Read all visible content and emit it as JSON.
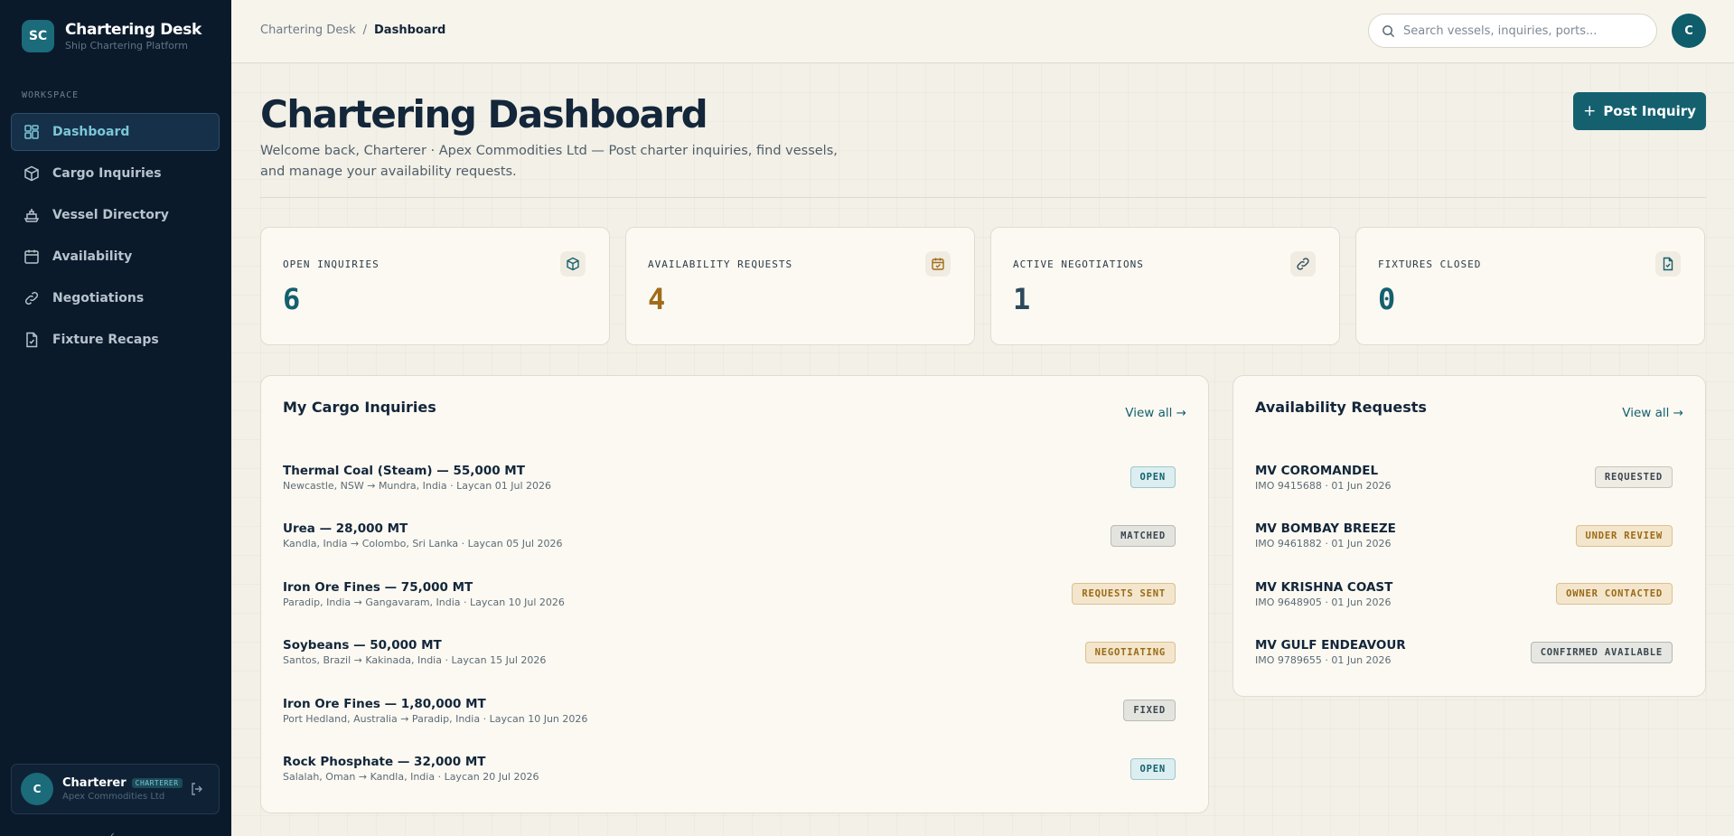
{
  "brand": {
    "logo": "SC",
    "title": "Chartering Desk",
    "subtitle": "Ship Chartering Platform"
  },
  "sidebar": {
    "section_label": "WORKSPACE",
    "items": [
      {
        "label": "Dashboard",
        "icon": "grid-icon"
      },
      {
        "label": "Cargo Inquiries",
        "icon": "box-icon"
      },
      {
        "label": "Vessel Directory",
        "icon": "ship-icon"
      },
      {
        "label": "Availability",
        "icon": "calendar-icon"
      },
      {
        "label": "Negotiations",
        "icon": "link-icon"
      },
      {
        "label": "Fixture Recaps",
        "icon": "document-icon"
      }
    ],
    "user": {
      "initial": "C",
      "name": "Charterer",
      "role": "CHARTERER",
      "org": "Apex Commodities Ltd"
    }
  },
  "topbar": {
    "breadcrumb": {
      "root": "Chartering Desk",
      "sep": "/",
      "current": "Dashboard"
    },
    "search_placeholder": "Search vessels, inquiries, ports...",
    "avatar": "C"
  },
  "page": {
    "title": "Chartering Dashboard",
    "subtitle": "Welcome back, Charterer · Apex Commodities Ltd — Post charter inquiries, find vessels, and manage your availability requests.",
    "post_button": {
      "plus": "+",
      "label": "Post Inquiry"
    }
  },
  "stats": [
    {
      "label": "OPEN INQUIRIES",
      "value": "6",
      "color": "#14606f",
      "icon": "box-icon"
    },
    {
      "label": "AVAILABILITY REQUESTS",
      "value": "4",
      "color": "#a06c1a",
      "icon": "calendar-check-icon"
    },
    {
      "label": "ACTIVE NEGOTIATIONS",
      "value": "1",
      "color": "#2c4a5c",
      "icon": "link-icon"
    },
    {
      "label": "FIXTURES CLOSED",
      "value": "0",
      "color": "#14606f",
      "icon": "document-check-icon"
    }
  ],
  "inquiries": {
    "title": "My Cargo Inquiries",
    "view_all": "View all →",
    "rows": [
      {
        "title": "Thermal Coal (Steam) — 55,000 MT",
        "sub": "Newcastle, NSW → Mundra, India · Laycan 01 Jul 2026",
        "status": "OPEN",
        "cls": "b-open"
      },
      {
        "title": "Urea — 28,000 MT",
        "sub": "Kandla, India → Colombo, Sri Lanka · Laycan 05 Jul 2026",
        "status": "MATCHED",
        "cls": "b-matched"
      },
      {
        "title": "Iron Ore Fines — 75,000 MT",
        "sub": "Paradip, India → Gangavaram, India · Laycan 10 Jul 2026",
        "status": "REQUESTS SENT",
        "cls": "b-amber"
      },
      {
        "title": "Soybeans — 50,000 MT",
        "sub": "Santos, Brazil → Kakinada, India · Laycan 15 Jul 2026",
        "status": "NEGOTIATING",
        "cls": "b-amber"
      },
      {
        "title": "Iron Ore Fines — 1,80,000 MT",
        "sub": "Port Hedland, Australia → Paradip, India · Laycan 10 Jun 2026",
        "status": "FIXED",
        "cls": "b-fixed"
      },
      {
        "title": "Rock Phosphate — 32,000 MT",
        "sub": "Salalah, Oman → Kandla, India · Laycan 20 Jul 2026",
        "status": "OPEN",
        "cls": "b-open"
      }
    ]
  },
  "availability": {
    "title": "Availability Requests",
    "view_all": "View all →",
    "rows": [
      {
        "title": "MV COROMANDEL",
        "sub": "IMO 9415688 · 01 Jun 2026",
        "status": "REQUESTED",
        "cls": "b-requested"
      },
      {
        "title": "MV BOMBAY BREEZE",
        "sub": "IMO 9461882 · 01 Jun 2026",
        "status": "UNDER REVIEW",
        "cls": "b-amber"
      },
      {
        "title": "MV KRISHNA COAST",
        "sub": "IMO 9648905 · 01 Jun 2026",
        "status": "OWNER CONTACTED",
        "cls": "b-amber"
      },
      {
        "title": "MV GULF ENDEAVOUR",
        "sub": "IMO 9789655 · 01 Jun 2026",
        "status": "CONFIRMED AVAILABLE",
        "cls": "b-confirmed"
      }
    ]
  }
}
